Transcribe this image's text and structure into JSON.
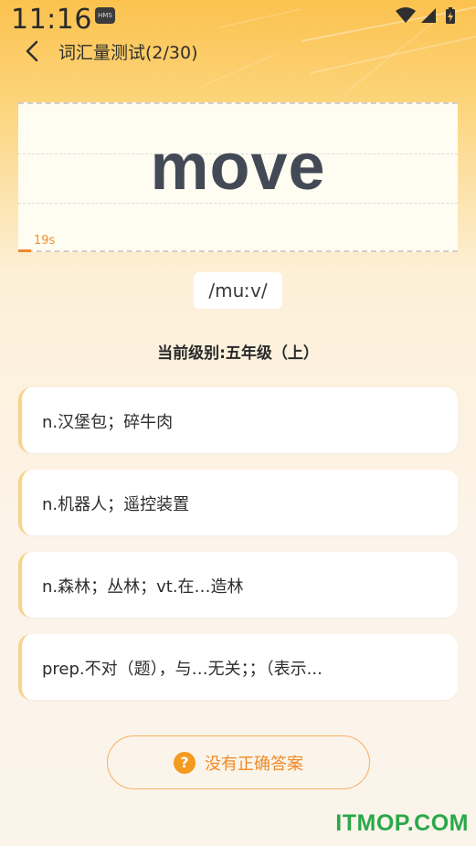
{
  "status_bar": {
    "time": "11:16",
    "badge": "HMS"
  },
  "header": {
    "title": "词汇量测试(2/30)"
  },
  "word_card": {
    "word": "move",
    "timer_label": "19s",
    "timer_progress": 0.03
  },
  "phonetic": "/muːv/",
  "level": "当前级别:五年级（上）",
  "options": [
    "n.汉堡包；碎牛肉",
    "n.机器人；遥控装置",
    "n.森林；丛林；vt.在…造林",
    "prep.不对（题），与…无关；；（表示..."
  ],
  "no_answer_button": {
    "label": "没有正确答案",
    "icon": "question-icon"
  },
  "watermark": "ITMOP.COM",
  "colors": {
    "accent": "#f08a26",
    "header_gradient": "#fbc24f",
    "word": "#434a56",
    "watermark": "#2aa84a"
  }
}
